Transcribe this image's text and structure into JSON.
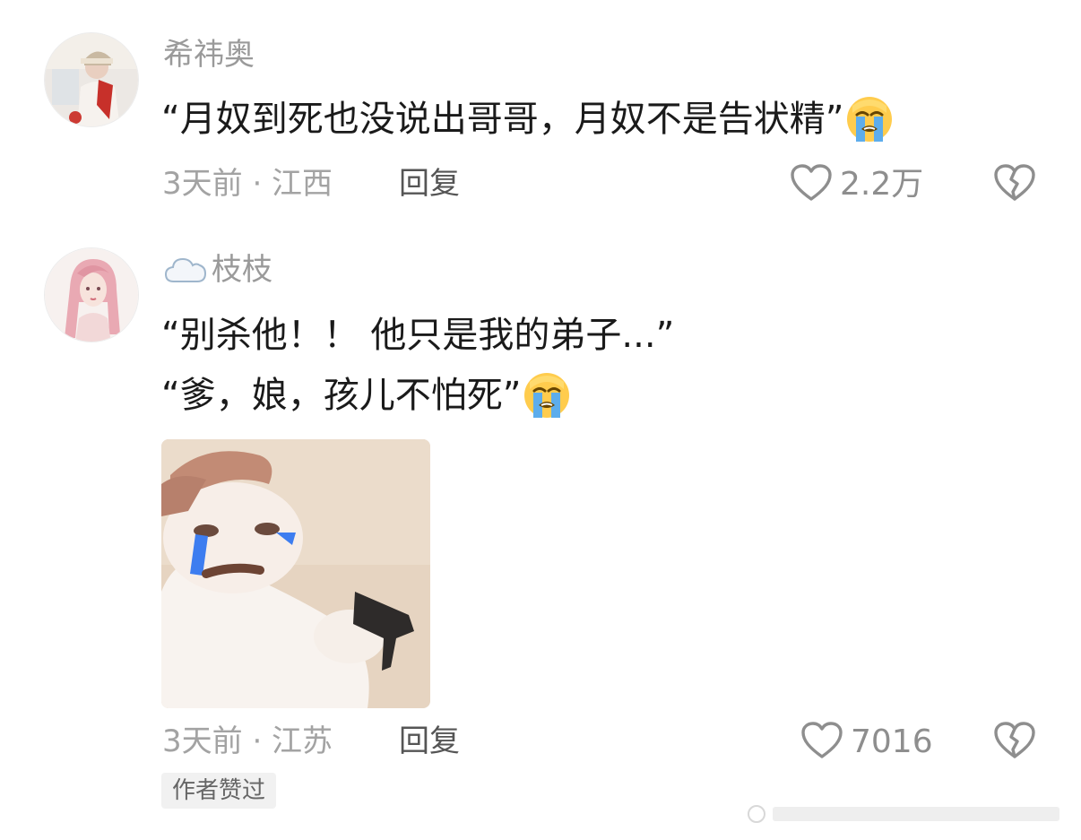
{
  "comments": [
    {
      "username": "希祎奥",
      "text_lines": [
        "“月奴到死也没说出哥哥，月奴不是告状精”"
      ],
      "meta": "3天前 · 江西",
      "reply_label": "回复",
      "likes": "2.2万"
    },
    {
      "username": "枝枝",
      "username_prefix_icon": "cloud-icon",
      "text_lines": [
        "“别杀他！！ 他只是我的弟子...”",
        "“爹，娘，孩儿不怕死”"
      ],
      "meta": "3天前 · 江苏",
      "reply_label": "回复",
      "likes": "7016",
      "badge": "作者赞过",
      "sticker": "crying-cat-with-gun-sticker"
    }
  ],
  "emoji": "loudly-crying-face-icon",
  "colors": {
    "username": "#9a9a9a",
    "text": "#1a1a1a",
    "meta": "#a3a3a3",
    "icon": "#8e8e8e",
    "badge_bg": "#f1f1f1"
  }
}
